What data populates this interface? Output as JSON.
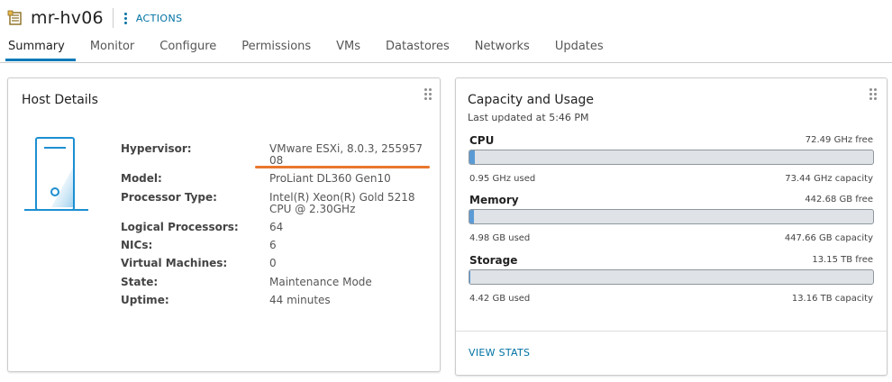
{
  "header": {
    "host_name": "mr-hv06",
    "actions_label": "ACTIONS"
  },
  "tabs": [
    {
      "label": "Summary",
      "active": true
    },
    {
      "label": "Monitor"
    },
    {
      "label": "Configure"
    },
    {
      "label": "Permissions"
    },
    {
      "label": "VMs"
    },
    {
      "label": "Datastores"
    },
    {
      "label": "Networks"
    },
    {
      "label": "Updates"
    }
  ],
  "host_details": {
    "title": "Host Details",
    "rows": [
      {
        "label": "Hypervisor:",
        "value": "VMware ESXi, 8.0.3, 25595708"
      },
      {
        "label": "Model:",
        "value": "ProLiant DL360 Gen10"
      },
      {
        "label": "Processor Type:",
        "value": "Intel(R) Xeon(R) Gold 5218 CPU @ 2.30GHz"
      },
      {
        "label": "Logical Processors:",
        "value": "64"
      },
      {
        "label": "NICs:",
        "value": "6"
      },
      {
        "label": "Virtual Machines:",
        "value": "0"
      },
      {
        "label": "State:",
        "value": "Maintenance Mode"
      },
      {
        "label": "Uptime:",
        "value": "44 minutes"
      }
    ]
  },
  "capacity": {
    "title": "Capacity and Usage",
    "last_updated": "Last updated at 5:46 PM",
    "resources": [
      {
        "name": "CPU",
        "free": "72.49 GHz free",
        "used": "0.95 GHz used",
        "capacity": "73.44 GHz capacity",
        "used_fraction": 0.013
      },
      {
        "name": "Memory",
        "free": "442.68 GB free",
        "used": "4.98 GB used",
        "capacity": "447.66 GB capacity",
        "used_fraction": 0.011
      },
      {
        "name": "Storage",
        "free": "13.15 TB free",
        "used": "4.42 GB used",
        "capacity": "13.16 TB capacity",
        "used_fraction": 0.0003
      }
    ],
    "view_stats_label": "VIEW STATS"
  },
  "colors": {
    "accent": "#0079b8",
    "link": "#0072a3",
    "highlight_underline": "#e8772e",
    "bar_fill": "#5b9bd5"
  }
}
